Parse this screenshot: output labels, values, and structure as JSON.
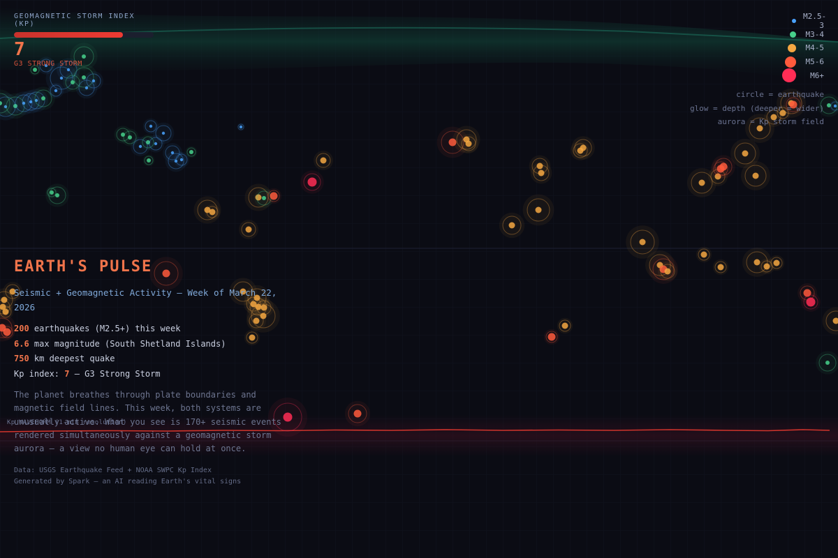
{
  "kp": {
    "title": "GEOMAGNETIC STORM INDEX (KP)",
    "value": "7",
    "level_fraction": 0.78,
    "status": "G3 STRONG STORM"
  },
  "legend": {
    "items": [
      {
        "label": "M2.5-3",
        "color": "#4aa3ff"
      },
      {
        "label": "M3-4",
        "color": "#47d18c"
      },
      {
        "label": "M4-5",
        "color": "#f5a742"
      },
      {
        "label": "M5-6",
        "color": "#ff5a3c"
      },
      {
        "label": "M6+",
        "color": "#ff2d55"
      }
    ],
    "notes": [
      "circle = earthquake",
      "glow = depth (deeper = wider)",
      "aurora = Kp storm field"
    ]
  },
  "info": {
    "title": "EARTH'S PULSE",
    "subtitle": "Seismic + Geomagnetic Activity — Week of March 22, 2026",
    "stats": [
      {
        "num": "200",
        "text": " earthquakes (M2.5+) this week"
      },
      {
        "num": "6.6",
        "text": " max magnitude (South Shetland Islands)"
      },
      {
        "num": "750",
        "text": " km deepest quake"
      }
    ],
    "kp_line_prefix": "Kp index: ",
    "kp_line_value": "7",
    "kp_line_suffix": " — G3 Strong Storm",
    "description": "The planet breathes through plate boundaries and magnetic field lines. This week, both systems are unusually active. What you see is 170+ seismic events rendered simultaneously against a geomagnetic storm aurora — a view no human eye can hold at once.",
    "credits": [
      "Data: USGS Earthquake Feed + NOAA SWPC Kp Index",
      "Generated by Spark — an AI reading Earth's vital signs"
    ]
  },
  "waveform": {
    "label": "Kp WAVEFORM (1-min resolution)"
  },
  "colors": {
    "accent": "#f0744b",
    "background": "#0b0c14",
    "aurora": "#1fbf8f",
    "wave": "#d0342c"
  }
}
